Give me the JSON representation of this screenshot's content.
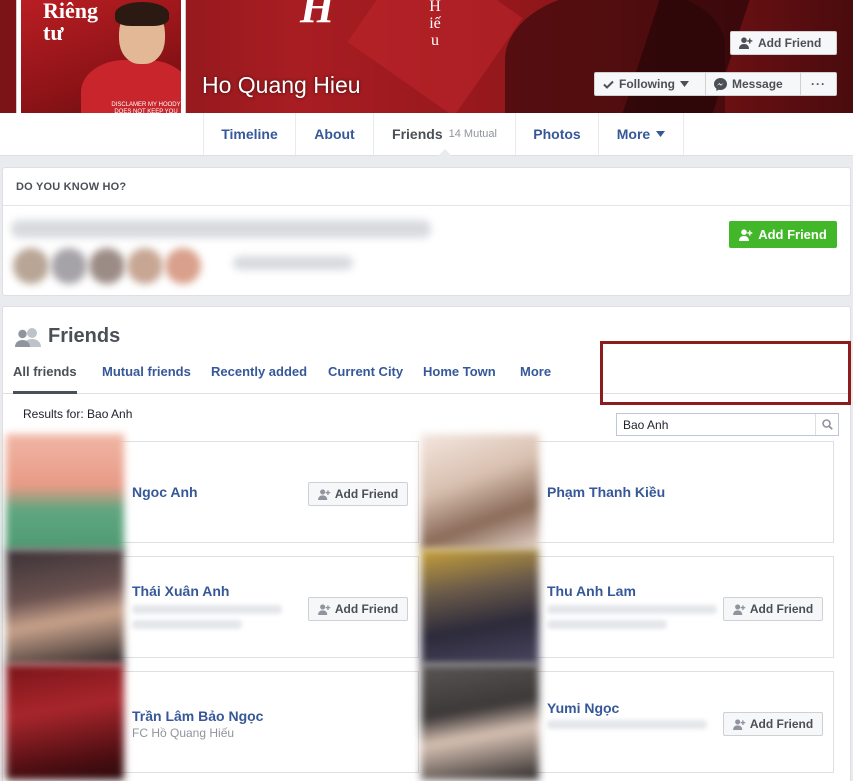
{
  "profile": {
    "name": "Ho Quang Hieu",
    "picture_text_line1": "Riêng",
    "picture_text_line2": "tư",
    "picture_small_text": "DISCLAMER MY HOODY DOES NOT KEEP YOU WARM",
    "cover_glyph": "H",
    "cover_vertical_text": "Hiếu"
  },
  "cover_actions": {
    "add_friend": "Add Friend",
    "following": "Following",
    "message": "Message",
    "more": "···"
  },
  "tabs": [
    {
      "label": "Timeline"
    },
    {
      "label": "About"
    },
    {
      "label": "Friends",
      "badge": "14 Mutual"
    },
    {
      "label": "Photos"
    },
    {
      "label": "More"
    }
  ],
  "do_you_know": {
    "title": "DO YOU KNOW HO?",
    "add_friend": "Add Friend"
  },
  "friends_section": {
    "title": "Friends",
    "subnav": [
      "All friends",
      "Mutual friends",
      "Recently added",
      "Current City",
      "Home Town",
      "More"
    ],
    "search_value": "Bao Anh",
    "results_label": "Results for: Bao Anh",
    "add_friend_label": "Add Friend",
    "results": [
      {
        "name": "Ngoc Anh",
        "subtitle": ""
      },
      {
        "name": "Phạm Thanh Kiều",
        "subtitle": ""
      },
      {
        "name": "Thái Xuân Anh",
        "subtitle": ""
      },
      {
        "name": "Thu Anh Lam",
        "subtitle": ""
      },
      {
        "name": "Trần Lâm Bảo Ngọc",
        "subtitle": "FC Hồ Quang Hiếu"
      },
      {
        "name": "Yumi Ngọc",
        "subtitle": ""
      }
    ]
  },
  "colors": {
    "link": "#365899",
    "green_button": "#42b72a",
    "highlight_border": "#8e1b1e",
    "cover_red": "#a81d22"
  }
}
